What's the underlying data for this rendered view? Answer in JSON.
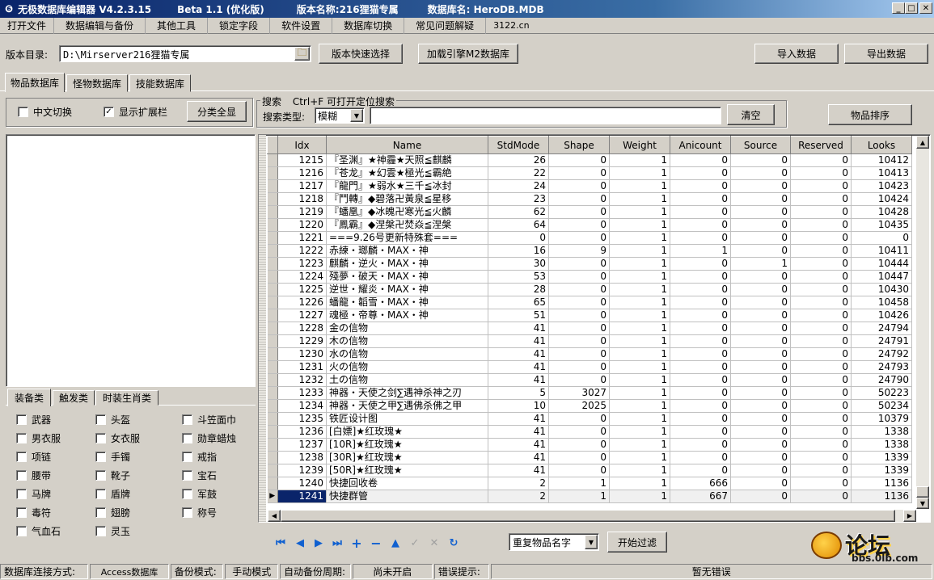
{
  "window": {
    "title": "无极数据库编辑器 V4.2.3.15",
    "beta": "Beta 1.1 (优化版)",
    "version_label": "版本名称:216狸猫专属",
    "db_label": "数据库名: HeroDB.MDB"
  },
  "menu": [
    "打开文件",
    "数据编辑与备份",
    "其他工具",
    "锁定字段",
    "软件设置",
    "数据库切换",
    "常见问题解疑",
    "3122.cn"
  ],
  "toolbar": {
    "dir_label": "版本目录:",
    "dir_value": "D:\\Mirserver216狸猫专属",
    "quick_select": "版本快速选择",
    "load_m2": "加载引擎M2数据库",
    "import": "导入数据",
    "export": "导出数据"
  },
  "tabs": [
    "物品数据库",
    "怪物数据库",
    "技能数据库"
  ],
  "options": {
    "chinese_switch": "中文切换",
    "show_ext": "显示扩展栏",
    "show_all": "分类全显"
  },
  "search": {
    "label": "搜索",
    "hint": "Ctrl+F 可打开定位搜索",
    "type_label": "搜索类型:",
    "type_value": "模糊",
    "clear": "清空",
    "sort": "物品排序"
  },
  "cat_tabs": [
    "装备类",
    "触发类",
    "时装生肖类"
  ],
  "categories": [
    "武器",
    "头盔",
    "斗笠面巾",
    "男衣服",
    "女衣服",
    "勋章蜡烛",
    "项链",
    "手镯",
    "戒指",
    "腰带",
    "靴子",
    "宝石",
    "马牌",
    "盾牌",
    "军鼓",
    "毒符",
    "翅膀",
    "称号",
    "气血石",
    "灵玉"
  ],
  "table": {
    "columns": [
      "Idx",
      "Name",
      "StdMode",
      "Shape",
      "Weight",
      "Anicount",
      "Source",
      "Reserved",
      "Looks"
    ],
    "rows": [
      [
        "1215",
        "『圣渊』★神霾★天照≦麒麟",
        "26",
        "0",
        "1",
        "0",
        "0",
        "0",
        "10412"
      ],
      [
        "1216",
        "『苍龙』★幻雲★極光≦霸絶",
        "22",
        "0",
        "1",
        "0",
        "0",
        "0",
        "10413"
      ],
      [
        "1217",
        "『龍門』★弱水★三千≦冰封",
        "24",
        "0",
        "1",
        "0",
        "0",
        "0",
        "10423"
      ],
      [
        "1218",
        "『鬥轉』◆碧落卍黃泉≦星移",
        "23",
        "0",
        "1",
        "0",
        "0",
        "0",
        "10424"
      ],
      [
        "1219",
        "『蟠凰』◆冰魄卍寒光≦火麟",
        "62",
        "0",
        "1",
        "0",
        "0",
        "0",
        "10428"
      ],
      [
        "1220",
        "『鳳霸』◆涅槃卍焚焱≦涅槃",
        "64",
        "0",
        "1",
        "0",
        "0",
        "0",
        "10435"
      ],
      [
        "1221",
        "===9.26号更新特殊套===",
        "0",
        "0",
        "1",
        "0",
        "0",
        "0",
        "0"
      ],
      [
        "1222",
        "赤練・瑯麟・MAX・神",
        "16",
        "9",
        "1",
        "1",
        "0",
        "0",
        "10411"
      ],
      [
        "1223",
        "麒麟・逆火・MAX・神",
        "30",
        "0",
        "1",
        "0",
        "1",
        "0",
        "10444"
      ],
      [
        "1224",
        "殘夢・破天・MAX・神",
        "53",
        "0",
        "1",
        "0",
        "0",
        "0",
        "10447"
      ],
      [
        "1225",
        "逆世・耀炎・MAX・神",
        "28",
        "0",
        "1",
        "0",
        "0",
        "0",
        "10430"
      ],
      [
        "1226",
        "蟠龍・韜雪・MAX・神",
        "65",
        "0",
        "1",
        "0",
        "0",
        "0",
        "10458"
      ],
      [
        "1227",
        "魂極・帝尊・MAX・神",
        "51",
        "0",
        "1",
        "0",
        "0",
        "0",
        "10426"
      ],
      [
        "1228",
        "金の信物",
        "41",
        "0",
        "1",
        "0",
        "0",
        "0",
        "24794"
      ],
      [
        "1229",
        "木の信物",
        "41",
        "0",
        "1",
        "0",
        "0",
        "0",
        "24791"
      ],
      [
        "1230",
        "水の信物",
        "41",
        "0",
        "1",
        "0",
        "0",
        "0",
        "24792"
      ],
      [
        "1231",
        "火の信物",
        "41",
        "0",
        "1",
        "0",
        "0",
        "0",
        "24793"
      ],
      [
        "1232",
        "土の信物",
        "41",
        "0",
        "1",
        "0",
        "0",
        "0",
        "24790"
      ],
      [
        "1233",
        "神器・天使之剑∑遇神杀神之刃",
        "5",
        "3027",
        "1",
        "0",
        "0",
        "0",
        "50223"
      ],
      [
        "1234",
        "神器・天使之甲∑遇佛杀佛之甲",
        "10",
        "2025",
        "1",
        "0",
        "0",
        "0",
        "50234"
      ],
      [
        "1235",
        "铁匠设计图",
        "41",
        "0",
        "1",
        "0",
        "0",
        "0",
        "10379"
      ],
      [
        "1236",
        "[白嫖]★红玫瑰★",
        "41",
        "0",
        "1",
        "0",
        "0",
        "0",
        "1338"
      ],
      [
        "1237",
        "[10R]★红玫瑰★",
        "41",
        "0",
        "1",
        "0",
        "0",
        "0",
        "1338"
      ],
      [
        "1238",
        "[30R]★红玫瑰★",
        "41",
        "0",
        "1",
        "0",
        "0",
        "0",
        "1339"
      ],
      [
        "1239",
        "[50R]★红玫瑰★",
        "41",
        "0",
        "1",
        "0",
        "0",
        "0",
        "1339"
      ],
      [
        "1240",
        "快捷回收卷",
        "2",
        "1",
        "1",
        "666",
        "0",
        "0",
        "1136"
      ],
      [
        "1241",
        "快捷群管",
        "2",
        "1",
        "1",
        "667",
        "0",
        "0",
        "1136"
      ]
    ]
  },
  "footer": {
    "dup_select": "重复物品名字",
    "filter": "开始过滤"
  },
  "status": {
    "conn_label": "数据库连接方式:",
    "conn_value": "Access数据库",
    "backup_label": "备份模式:",
    "backup_value": "手动模式",
    "auto_label": "自动备份周期:",
    "auto_value": "尚未开启",
    "err_label": "错误提示:",
    "err_value": "暂无错误"
  },
  "watermark": {
    "text": "论坛",
    "url": "bbs.0lb.com"
  }
}
